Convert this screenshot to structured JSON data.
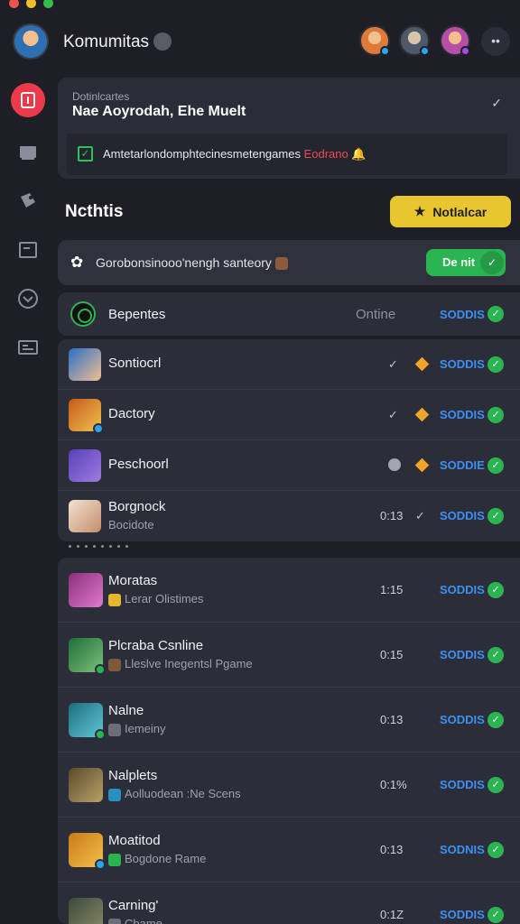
{
  "window_controls": [
    "#ee5252",
    "#f3be2d",
    "#33c04a"
  ],
  "header": {
    "title": "Komumitas",
    "friends": [
      {
        "name": "friend-avatar-1",
        "color": "#e07a3a",
        "badge": "#2aa6e8"
      },
      {
        "name": "friend-avatar-2",
        "color": "#4d5a6a",
        "badge": "#2aa6e8"
      },
      {
        "name": "friend-avatar-3",
        "color": "#b54ea5",
        "badge": "#a24ee0"
      }
    ],
    "more_label": "••"
  },
  "sidebar": {
    "items": [
      {
        "name": "sidebar-home-icon",
        "active": true
      },
      {
        "name": "sidebar-library-icon",
        "active": false
      },
      {
        "name": "sidebar-tags-icon",
        "active": false
      },
      {
        "name": "sidebar-window-icon",
        "active": false
      },
      {
        "name": "sidebar-download-icon",
        "active": false
      },
      {
        "name": "sidebar-news-icon",
        "active": false
      }
    ]
  },
  "top_card": {
    "subtitle": "Dotinlcartes",
    "title": "Nae Aoyrodah, Ehe Muelt",
    "chevron": "✓",
    "notice_text": "Amtetarlondomphtecinesmetengames",
    "notice_link": "Eodrano",
    "notice_emoji": "🔔"
  },
  "section": {
    "title": "Ncthtis",
    "notify_label": "Notlalcar",
    "notify_icon": "★"
  },
  "bar": {
    "icon": "✿",
    "text": "Gorobonsinooo'nengh santeory",
    "toggle_label": "De nit",
    "toggle_knob": "✓"
  },
  "online_row": {
    "name": "Bepentes",
    "status_text": "Ontine",
    "state": "SODDIS"
  },
  "group1": [
    {
      "name": "Sontiocrl",
      "meta": "",
      "chevron": "✓",
      "marker": "diamond",
      "state": "SODDIS",
      "thumb": [
        "#2a6fc9",
        "#f0c08f"
      ],
      "badge": ""
    },
    {
      "name": "Dactory",
      "meta": "",
      "chevron": "✓",
      "marker": "diamond",
      "state": "SODDIS",
      "thumb": [
        "#c65a1a",
        "#f0c150"
      ],
      "badge": "#2aa6e8"
    },
    {
      "name": "Peschoorl",
      "meta": "",
      "chevron": "",
      "marker": "dot+diamond",
      "state": "SODDIE",
      "thumb": [
        "#5a3fb8",
        "#9b7de0"
      ],
      "badge": ""
    },
    {
      "name": "Borgnock",
      "sub": "Bocidote",
      "meta": "0:13",
      "chevron": "✓",
      "marker": "",
      "state": "SODDIS",
      "thumb": [
        "#f2e2d2",
        "#c58d6a"
      ],
      "badge": ""
    }
  ],
  "group2": [
    {
      "name": "Moratas",
      "sub": "Lerar Olistimes",
      "meta": "1:15",
      "state": "SODDIS",
      "thumb": [
        "#8a2f7a",
        "#e07ad0"
      ],
      "badge": "",
      "sub_icon": "#e6b630"
    },
    {
      "name": "Plcraba Csnline",
      "sub": "Lleslve Inegentsl  Pgame",
      "meta": "0:15",
      "state": "SODDIS",
      "thumb": [
        "#1f6e3a",
        "#7ec07a"
      ],
      "badge": "#2bb552",
      "sub_icon": "#7a5a3a"
    },
    {
      "name": "Nalne",
      "sub": "Iemeiny",
      "meta": "0:13",
      "state": "SODDIS",
      "thumb": [
        "#1e6c7a",
        "#5ec8d9"
      ],
      "badge": "#2bb552",
      "sub_icon": "#6c6f7a"
    },
    {
      "name": "Nalplets",
      "sub": "Aolluodean :Ne Scens",
      "meta": "0:1%",
      "state": "SODDIS",
      "thumb": [
        "#5a4a2a",
        "#b8a26a"
      ],
      "badge": "",
      "sub_icon": "#2a8fbf"
    },
    {
      "name": "Moatitod",
      "sub": "Bogdone Rame",
      "meta": "0:13",
      "state": "SODNIS",
      "thumb": [
        "#c97a1a",
        "#f6c04a"
      ],
      "badge": "#2aa6e8",
      "sub_icon": "#2bb552"
    },
    {
      "name": "Carning'",
      "sub": "Cbame",
      "meta": "0:1Z",
      "state": "SODDIS",
      "thumb": [
        "#3a4a3a",
        "#8a8a6a"
      ],
      "badge": "",
      "sub_icon": "#6c6f7a"
    }
  ]
}
